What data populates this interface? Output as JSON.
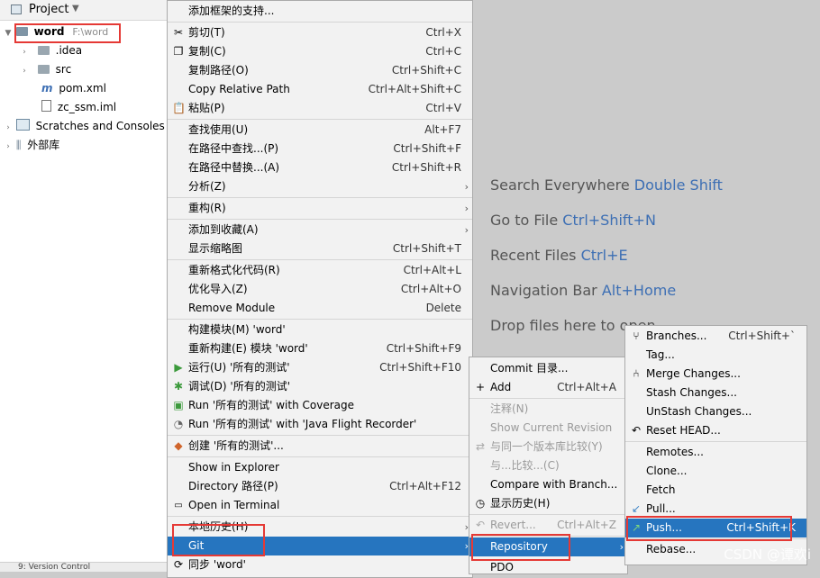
{
  "project_panel": {
    "title": "Project",
    "tree": [
      {
        "name": "word",
        "path": "F:\\word"
      },
      {
        "name": ".idea"
      },
      {
        "name": "src"
      },
      {
        "name": "pom.xml"
      },
      {
        "name": "zc_ssm.iml"
      },
      {
        "name": "Scratches and Consoles"
      },
      {
        "name": "外部库"
      }
    ],
    "bottom_tab": "9: Version Control"
  },
  "editor_hints": [
    {
      "text": "Search Everywhere",
      "key": "Double Shift"
    },
    {
      "text": "Go to File",
      "key": "Ctrl+Shift+N"
    },
    {
      "text": "Recent Files",
      "key": "Ctrl+E"
    },
    {
      "text": "Navigation Bar",
      "key": "Alt+Home"
    },
    {
      "text": "Drop files here to open",
      "key": ""
    }
  ],
  "context_menu": [
    {
      "label": "添加框架的支持...",
      "shortcut": ""
    },
    {
      "label": "剪切(T)",
      "shortcut": "Ctrl+X",
      "icon": "scissors-icon"
    },
    {
      "label": "复制(C)",
      "shortcut": "Ctrl+C",
      "icon": "copy-icon"
    },
    {
      "label": "复制路径(O)",
      "shortcut": "Ctrl+Shift+C"
    },
    {
      "label": "Copy Relative Path",
      "shortcut": "Ctrl+Alt+Shift+C"
    },
    {
      "label": "粘贴(P)",
      "shortcut": "Ctrl+V",
      "icon": "paste-icon"
    },
    {
      "label": "查找使用(U)",
      "shortcut": "Alt+F7"
    },
    {
      "label": "在路径中查找...(P)",
      "shortcut": "Ctrl+Shift+F"
    },
    {
      "label": "在路径中替换...(A)",
      "shortcut": "Ctrl+Shift+R"
    },
    {
      "label": "分析(Z)",
      "shortcut": ""
    },
    {
      "label": "重构(R)",
      "shortcut": ""
    },
    {
      "label": "添加到收藏(A)",
      "shortcut": ""
    },
    {
      "label": "显示缩略图",
      "shortcut": "Ctrl+Shift+T"
    },
    {
      "label": "重新格式化代码(R)",
      "shortcut": "Ctrl+Alt+L"
    },
    {
      "label": "优化导入(Z)",
      "shortcut": "Ctrl+Alt+O"
    },
    {
      "label": "Remove Module",
      "shortcut": "Delete"
    },
    {
      "label": "构建模块(M) 'word'",
      "shortcut": ""
    },
    {
      "label": "重新构建(E) 模块 'word'",
      "shortcut": "Ctrl+Shift+F9"
    },
    {
      "label": "运行(U) '所有的测试'",
      "shortcut": "Ctrl+Shift+F10",
      "icon": "run-icon"
    },
    {
      "label": "调试(D) '所有的测试'",
      "shortcut": "",
      "icon": "debug-icon"
    },
    {
      "label": "Run '所有的测试' with Coverage",
      "shortcut": "",
      "icon": "coverage-icon"
    },
    {
      "label": "Run '所有的测试' with 'Java Flight Recorder'",
      "shortcut": "",
      "icon": "profiler-icon"
    },
    {
      "label": "创建 '所有的测试'...",
      "shortcut": "",
      "icon": "create-config-icon"
    },
    {
      "label": "Show in Explorer",
      "shortcut": ""
    },
    {
      "label": "Directory 路径(P)",
      "shortcut": "Ctrl+Alt+F12"
    },
    {
      "label": "Open in Terminal",
      "shortcut": "",
      "icon": "terminal-icon"
    },
    {
      "label": "本地历史(H)",
      "shortcut": ""
    },
    {
      "label": "Git",
      "shortcut": ""
    },
    {
      "label": "同步 'word'",
      "shortcut": ""
    }
  ],
  "git_submenu": [
    {
      "label": "Commit 目录...",
      "shortcut": ""
    },
    {
      "label": "Add",
      "shortcut": "Ctrl+Alt+A"
    },
    {
      "label": "注释(N)",
      "shortcut": ""
    },
    {
      "label": "Show Current Revision",
      "shortcut": ""
    },
    {
      "label": "与同一个版本库比较(Y)",
      "shortcut": ""
    },
    {
      "label": "与...比较...(C)",
      "shortcut": ""
    },
    {
      "label": "Compare with Branch...",
      "shortcut": ""
    },
    {
      "label": "显示历史(H)",
      "shortcut": ""
    },
    {
      "label": "Revert...",
      "shortcut": "Ctrl+Alt+Z"
    },
    {
      "label": "Repository",
      "shortcut": ""
    },
    {
      "label": "PDO",
      "shortcut": ""
    }
  ],
  "repository_submenu": [
    {
      "label": "Branches...",
      "shortcut": "Ctrl+Shift+`"
    },
    {
      "label": "Tag...",
      "shortcut": ""
    },
    {
      "label": "Merge Changes...",
      "shortcut": ""
    },
    {
      "label": "Stash Changes...",
      "shortcut": ""
    },
    {
      "label": "UnStash Changes...",
      "shortcut": ""
    },
    {
      "label": "Reset HEAD...",
      "shortcut": ""
    },
    {
      "label": "Remotes...",
      "shortcut": ""
    },
    {
      "label": "Clone...",
      "shortcut": ""
    },
    {
      "label": "Fetch",
      "shortcut": ""
    },
    {
      "label": "Pull...",
      "shortcut": ""
    },
    {
      "label": "Push...",
      "shortcut": "Ctrl+Shift+K"
    },
    {
      "label": "Rebase...",
      "shortcut": ""
    }
  ],
  "watermark": "CSDN @谭欢i"
}
